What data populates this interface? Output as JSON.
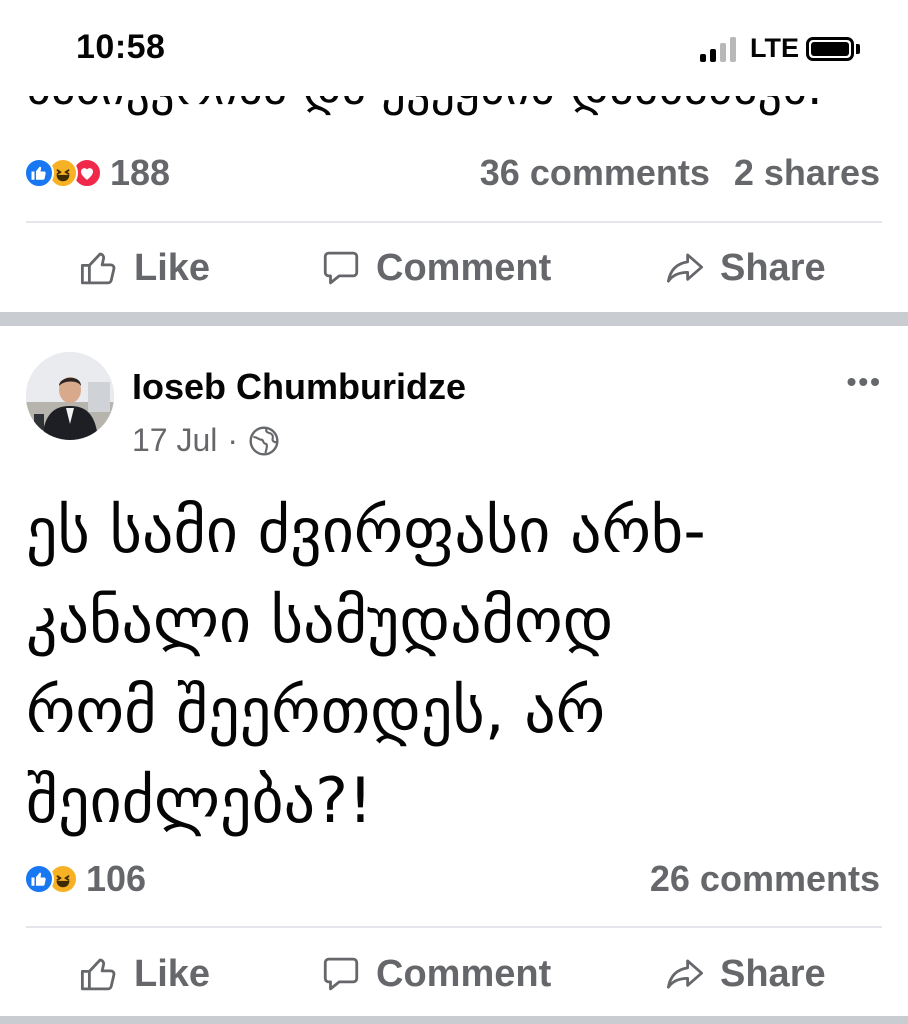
{
  "status_bar": {
    "time": "10:58",
    "network": "LTE"
  },
  "previous_post": {
    "truncated_text": "ნაბიჭვრისა და ქვეყნის დამბაძავს.",
    "reaction_count": "188",
    "comments": "36 comments",
    "shares": "2 shares",
    "reactions": [
      "like-icon",
      "haha-icon",
      "love-icon"
    ]
  },
  "post": {
    "author": "Ioseb Chumburidze",
    "date": "17 Jul",
    "separator": "·",
    "more": "•••",
    "text_lines": [
      "ეს სამი ძვირფასი არხ-",
      "კანალი სამუდამოდ",
      "რომ შეერთდეს, არ",
      "შეიძლება?!"
    ],
    "reaction_count": "106",
    "comments": "26 comments",
    "reactions": [
      "like-icon",
      "haha-icon"
    ]
  },
  "actions": {
    "like": "Like",
    "comment": "Comment",
    "share": "Share"
  },
  "colors": {
    "facebook_blue": "#1877f2",
    "haha_yellow": "#f7b125",
    "love_red": "#f02849",
    "secondary_text": "#65676b",
    "separator": "#c9ccd1"
  }
}
